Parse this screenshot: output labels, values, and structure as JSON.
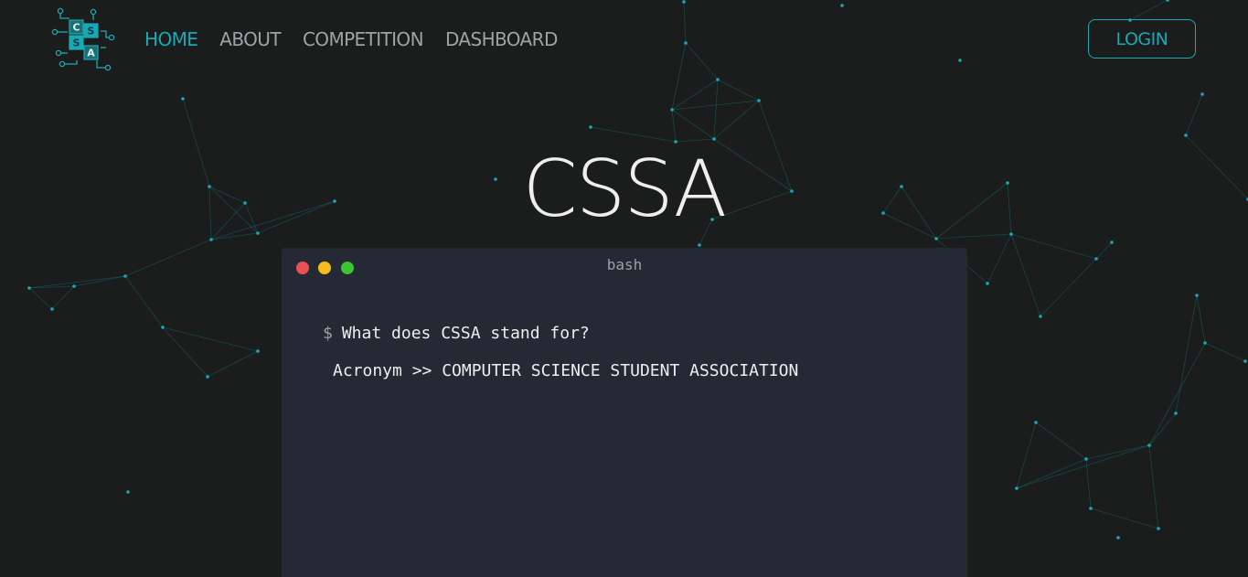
{
  "colors": {
    "background": "#1b1c1c",
    "accent": "#19a9b5",
    "nav_text": "#9fa3a5",
    "terminal_bg": "#252933"
  },
  "logo": {
    "letters": [
      "C",
      "S",
      "S",
      "A"
    ]
  },
  "nav": {
    "items": [
      {
        "label": "HOME",
        "active": true
      },
      {
        "label": "ABOUT",
        "active": false
      },
      {
        "label": "COMPETITION",
        "active": false
      },
      {
        "label": "DASHBOARD",
        "active": false
      }
    ],
    "login_label": "LOGIN"
  },
  "hero": {
    "title": "CSSA"
  },
  "terminal": {
    "title": "bash",
    "prompt_symbol": "$",
    "command": "What does CSSA stand for?",
    "output": "Acronym >> COMPUTER SCIENCE STUDENT ASSOCIATION"
  }
}
